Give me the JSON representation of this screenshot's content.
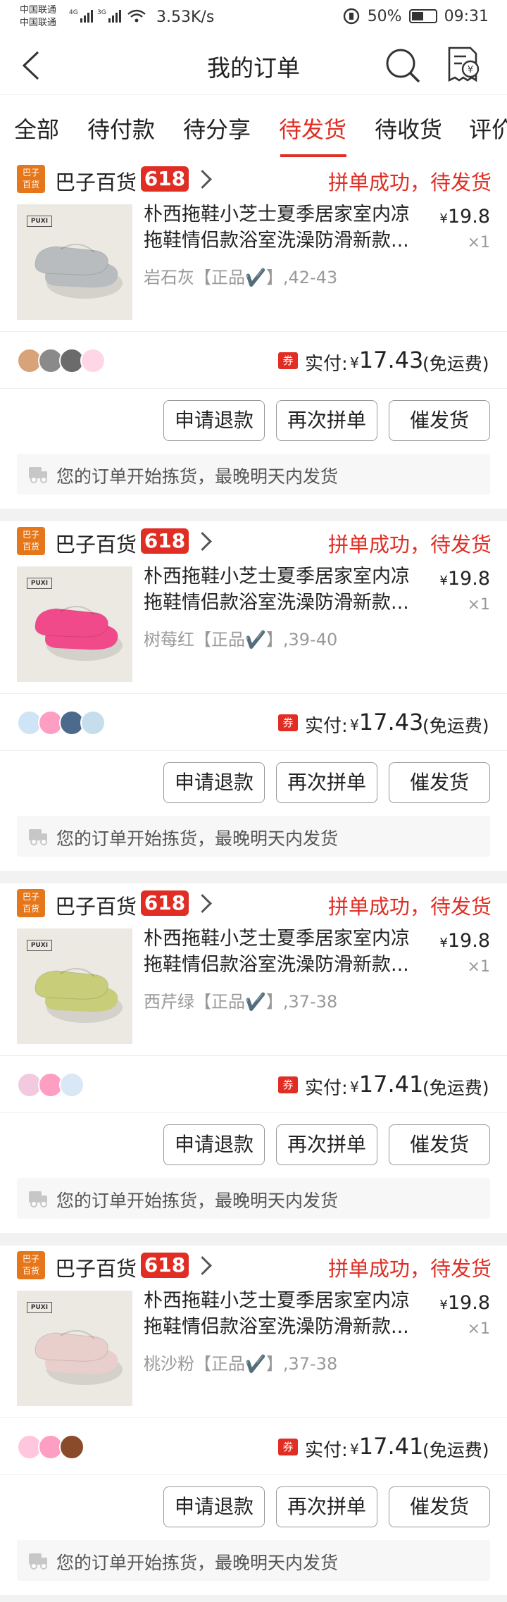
{
  "status_bar": {
    "carrier1": "中国联通",
    "carrier2": "中国联通",
    "net1": "4G",
    "net2": "3G",
    "speed": "3.53K/s",
    "battery": "50%",
    "time": "09:31"
  },
  "nav": {
    "title": "我的订单",
    "back_icon": "back-arrow-icon",
    "search_icon": "search-icon",
    "bill_icon": "bill-icon"
  },
  "tabs": [
    "全部",
    "待付款",
    "待分享",
    "待发货",
    "待收货",
    "评价"
  ],
  "active_tab": "待发货",
  "accent": "#e02e24",
  "orders": [
    {
      "shop_badge": "巴子\n百货",
      "shop_name": "巴子百货",
      "promo": "618",
      "status": "拼单成功，待发货",
      "product_line1": "朴西拖鞋小芝士夏季居家室内凉",
      "product_line2": "拖鞋情侣款浴室洗澡防滑新款...",
      "spec": "岩石灰【正品✔️】,42-43",
      "price_symbol": "¥",
      "price": "19.8",
      "qty": "×1",
      "slipper_color": "#b9bcbf",
      "coupon": "券",
      "paid_label": "实付:",
      "paid_symbol": "¥",
      "paid": "17.43",
      "shipping": "(免运费)",
      "btn_refund": "申请退款",
      "btn_again": "再次拼单",
      "btn_urge": "催发货",
      "notice": "您的订单开始拣货，最晚明天内发货"
    },
    {
      "shop_badge": "巴子\n百货",
      "shop_name": "巴子百货",
      "promo": "618",
      "status": "拼单成功，待发货",
      "product_line1": "朴西拖鞋小芝士夏季居家室内凉",
      "product_line2": "拖鞋情侣款浴室洗澡防滑新款...",
      "spec": "树莓红【正品✔️】,39-40",
      "price_symbol": "¥",
      "price": "19.8",
      "qty": "×1",
      "slipper_color": "#f04a8a",
      "coupon": "券",
      "paid_label": "实付:",
      "paid_symbol": "¥",
      "paid": "17.43",
      "shipping": "(免运费)",
      "btn_refund": "申请退款",
      "btn_again": "再次拼单",
      "btn_urge": "催发货",
      "notice": "您的订单开始拣货，最晚明天内发货"
    },
    {
      "shop_badge": "巴子\n百货",
      "shop_name": "巴子百货",
      "promo": "618",
      "status": "拼单成功，待发货",
      "product_line1": "朴西拖鞋小芝士夏季居家室内凉",
      "product_line2": "拖鞋情侣款浴室洗澡防滑新款...",
      "spec": "西芹绿【正品✔️】,37-38",
      "price_symbol": "¥",
      "price": "19.8",
      "qty": "×1",
      "slipper_color": "#c8cd7a",
      "coupon": "券",
      "paid_label": "实付:",
      "paid_symbol": "¥",
      "paid": "17.41",
      "shipping": "(免运费)",
      "btn_refund": "申请退款",
      "btn_again": "再次拼单",
      "btn_urge": "催发货",
      "notice": "您的订单开始拣货，最晚明天内发货"
    },
    {
      "shop_badge": "巴子\n百货",
      "shop_name": "巴子百货",
      "promo": "618",
      "status": "拼单成功，待发货",
      "product_line1": "朴西拖鞋小芝士夏季居家室内凉",
      "product_line2": "拖鞋情侣款浴室洗澡防滑新款...",
      "spec": "桃沙粉【正品✔️】,37-38",
      "price_symbol": "¥",
      "price": "19.8",
      "qty": "×1",
      "slipper_color": "#e8cfcc",
      "coupon": "券",
      "paid_label": "实付:",
      "paid_symbol": "¥",
      "paid": "17.41",
      "shipping": "(免运费)",
      "btn_refund": "申请退款",
      "btn_again": "再次拼单",
      "btn_urge": "催发货",
      "notice": "您的订单开始拣货，最晚明天内发货"
    }
  ]
}
